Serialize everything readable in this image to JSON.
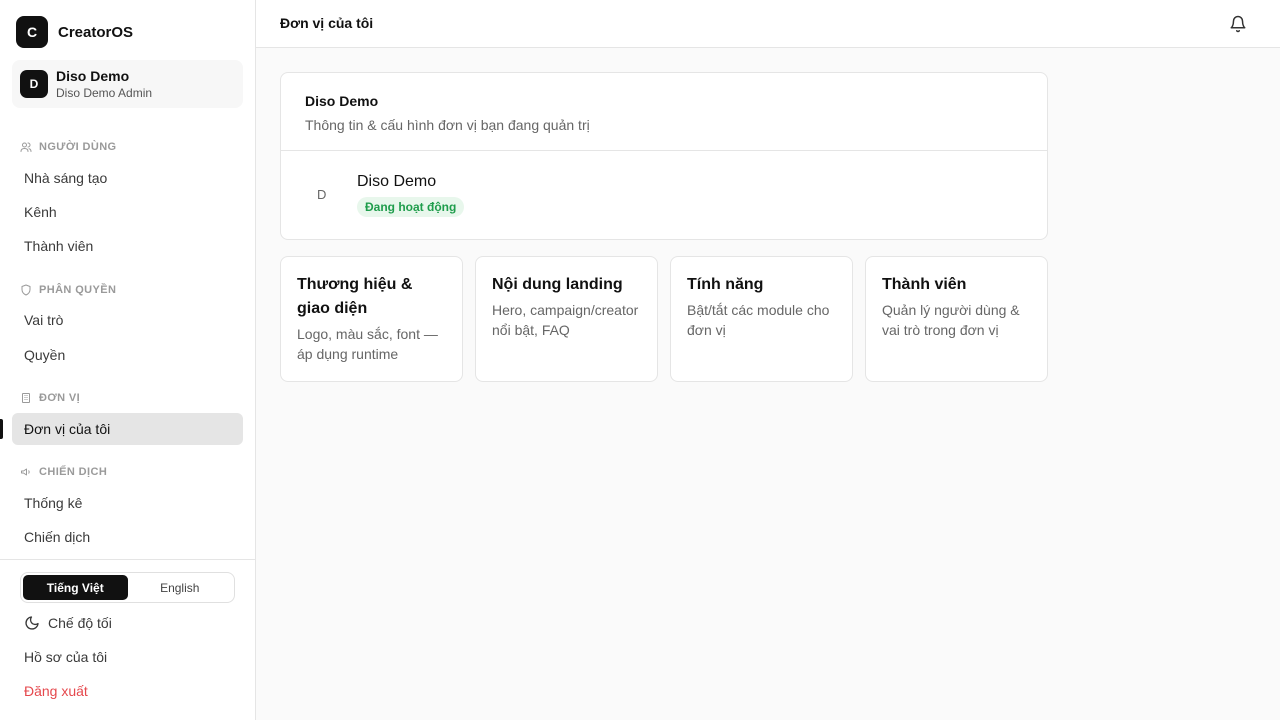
{
  "brand": {
    "logo_letter": "C",
    "name": "CreatorOS"
  },
  "org": {
    "avatar_letter": "D",
    "name": "Diso Demo",
    "role": "Diso Demo Admin"
  },
  "sidebar": {
    "sections": [
      {
        "title": "NGƯỜI DÙNG",
        "icon": "users-icon",
        "items": [
          "Nhà sáng tạo",
          "Kênh",
          "Thành viên"
        ]
      },
      {
        "title": "PHÂN QUYỀN",
        "icon": "shield-icon",
        "items": [
          "Vai trò",
          "Quyền"
        ]
      },
      {
        "title": "ĐƠN VỊ",
        "icon": "building-icon",
        "items": [
          "Đơn vị của tôi"
        ]
      },
      {
        "title": "CHIẾN DỊCH",
        "icon": "megaphone-icon",
        "items": [
          "Thống kê",
          "Chiến dịch"
        ]
      }
    ],
    "active_item": "Đơn vị của tôi"
  },
  "language": {
    "options": [
      "Tiếng Việt",
      "English"
    ],
    "selected": "Tiếng Việt"
  },
  "bottom": {
    "dark_mode": "Chế độ tối",
    "profile": "Hồ sơ của tôi",
    "logout": "Đăng xuất"
  },
  "header": {
    "title": "Đơn vị của tôi",
    "bell_icon": "bell-icon"
  },
  "unit_card": {
    "title": "Diso Demo",
    "subtitle": "Thông tin & cấu hình đơn vị bạn đang quản trị",
    "avatar_letter": "D",
    "name": "Diso Demo",
    "status": "Đang hoạt động"
  },
  "features": [
    {
      "title": "Thương hiệu & giao diện",
      "desc": "Logo, màu sắc, font — áp dụng runtime"
    },
    {
      "title": "Nội dung landing",
      "desc": "Hero, campaign/creator nổi bật, FAQ"
    },
    {
      "title": "Tính năng",
      "desc": "Bật/tắt các module cho đơn vị"
    },
    {
      "title": "Thành viên",
      "desc": "Quản lý người dùng & vai trò trong đơn vị"
    }
  ],
  "colors": {
    "accent": "#111111",
    "active_bg": "#e5e5e5",
    "success": "#1f9d4c",
    "success_bg": "#e8f7ec",
    "danger": "#e5484d"
  }
}
